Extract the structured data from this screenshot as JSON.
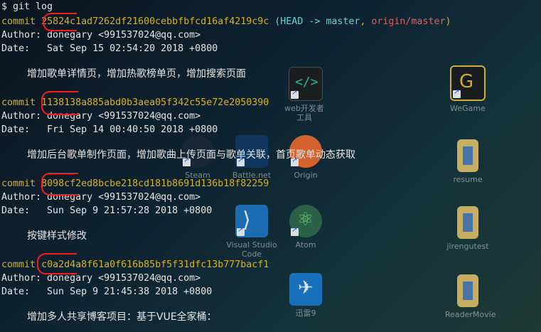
{
  "desktop": {
    "icons": [
      {
        "label": "WeGame",
        "icon": "wegame-icon",
        "color": "#1a1a1a",
        "accent": "#f2c230"
      },
      {
        "label": "resume",
        "icon": "folder-icon",
        "color": "#e6c46a",
        "accent": "#2a6cd4"
      },
      {
        "label": "jirengutest",
        "icon": "folder-icon",
        "color": "#e6c46a",
        "accent": "#2a6cd4"
      },
      {
        "label": "ReaderMovie",
        "icon": "folder-icon",
        "color": "#e6c46a",
        "accent": "#2a6cd4"
      },
      {
        "label": "Visual Studio Code",
        "icon": "vscode-icon",
        "color": "#1f78c8",
        "accent": "#ffffff"
      },
      {
        "label": "Atom",
        "icon": "atom-icon",
        "color": "#2f6b4a",
        "accent": "#7fe07f"
      },
      {
        "label": "迅雷9",
        "icon": "thunder-icon",
        "color": "#1a7bd4",
        "accent": "#ffffff"
      },
      {
        "label": "Steam",
        "icon": "steam-icon",
        "color": "#1b2838",
        "accent": "#c7d5e0"
      },
      {
        "label": "Battle.net",
        "icon": "battlenet-icon",
        "color": "#0f3a66",
        "accent": "#4aa3ff"
      },
      {
        "label": "Origin",
        "icon": "origin-icon",
        "color": "#f56c2d",
        "accent": "#ffffff"
      },
      {
        "label": "web开发者工具",
        "icon": "devtools-icon",
        "color": "#1e1e1e",
        "accent": "#2fd0a0"
      }
    ]
  },
  "terminal": {
    "prompt": "$ git log",
    "commits": [
      {
        "keyword": "commit",
        "hash": "25824c1ad7262df21600cebbfbfcd16af4219c9c",
        "refs_open": " (",
        "head": "HEAD -> master",
        "sep": ", ",
        "origin": "origin/master",
        "refs_close": ")",
        "author": "Author: donegary <991537024@qq.com>",
        "date": "Date:   Sat Sep 15 02:54:20 2018 +0800",
        "message": "增加歌单详情页，增加热歌榜单页，增加搜索页面"
      },
      {
        "keyword": "commit",
        "hash": "1138138a885abd0b3aea05f342c55e72e2050390",
        "author": "Author: donegary <991537024@qq.com>",
        "date": "Date:   Fri Sep 14 00:40:50 2018 +0800",
        "message": "增加后台歌单制作页面，增加歌曲上传页面与歌单关联，首页歌单动态获取"
      },
      {
        "keyword": "commit",
        "hash": "8098cf2ed8bcbe218cd181b8691d136b18f82259",
        "author": "Author: donegary <991537024@qq.com>",
        "date": "Date:   Sun Sep 9 21:57:28 2018 +0800",
        "message": "按键样式修改"
      },
      {
        "keyword": "commit",
        "hash": "c0a2d4a8f61a0f616b85bf5f31dfc13b777bacf1",
        "author": "Author: donegary <991537024@qq.com>",
        "date": "Date:   Sun Sep 9 21:45:38 2018 +0800",
        "message": "增加多人共享博客项目：基于VUE全家桶："
      }
    ]
  },
  "colors": {
    "hash": "#d7b12d",
    "head": "#5fd7d7",
    "master": "#5fd75f",
    "origin": "#e05f5f",
    "annotation": "#ff1a1a"
  }
}
